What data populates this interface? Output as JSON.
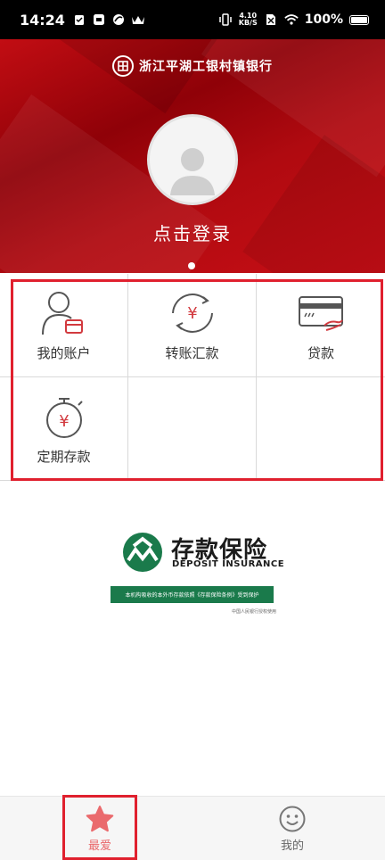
{
  "status_bar": {
    "time": "14:24",
    "net_speed_value": "4.10",
    "net_speed_unit": "KB/S",
    "battery": "100%"
  },
  "header": {
    "bank_name": "浙江平湖工银村镇银行",
    "login_prompt": "点击登录"
  },
  "menu": {
    "items": [
      {
        "label": "我的账户",
        "icon": "account-card-icon"
      },
      {
        "label": "转账汇款",
        "icon": "transfer-yuan-icon"
      },
      {
        "label": "贷款",
        "icon": "loan-card-icon"
      },
      {
        "label": "定期存款",
        "icon": "timer-yuan-icon"
      }
    ]
  },
  "deposit_insurance": {
    "title": "存款保险",
    "subtitle": "DEPOSIT INSURANCE",
    "bar_text": "本机构吸收的本外币存款依照《存款保险条例》受到保护",
    "note": "中国人民银行授权使用"
  },
  "tabbar": {
    "tabs": [
      {
        "label": "最爱",
        "icon": "star-icon",
        "active": true
      },
      {
        "label": "我的",
        "icon": "smiley-icon",
        "active": false
      }
    ]
  },
  "colors": {
    "brand_red": "#c20d13",
    "accent_pink": "#ea6a6d",
    "deposit_green": "#1a7a4b"
  }
}
